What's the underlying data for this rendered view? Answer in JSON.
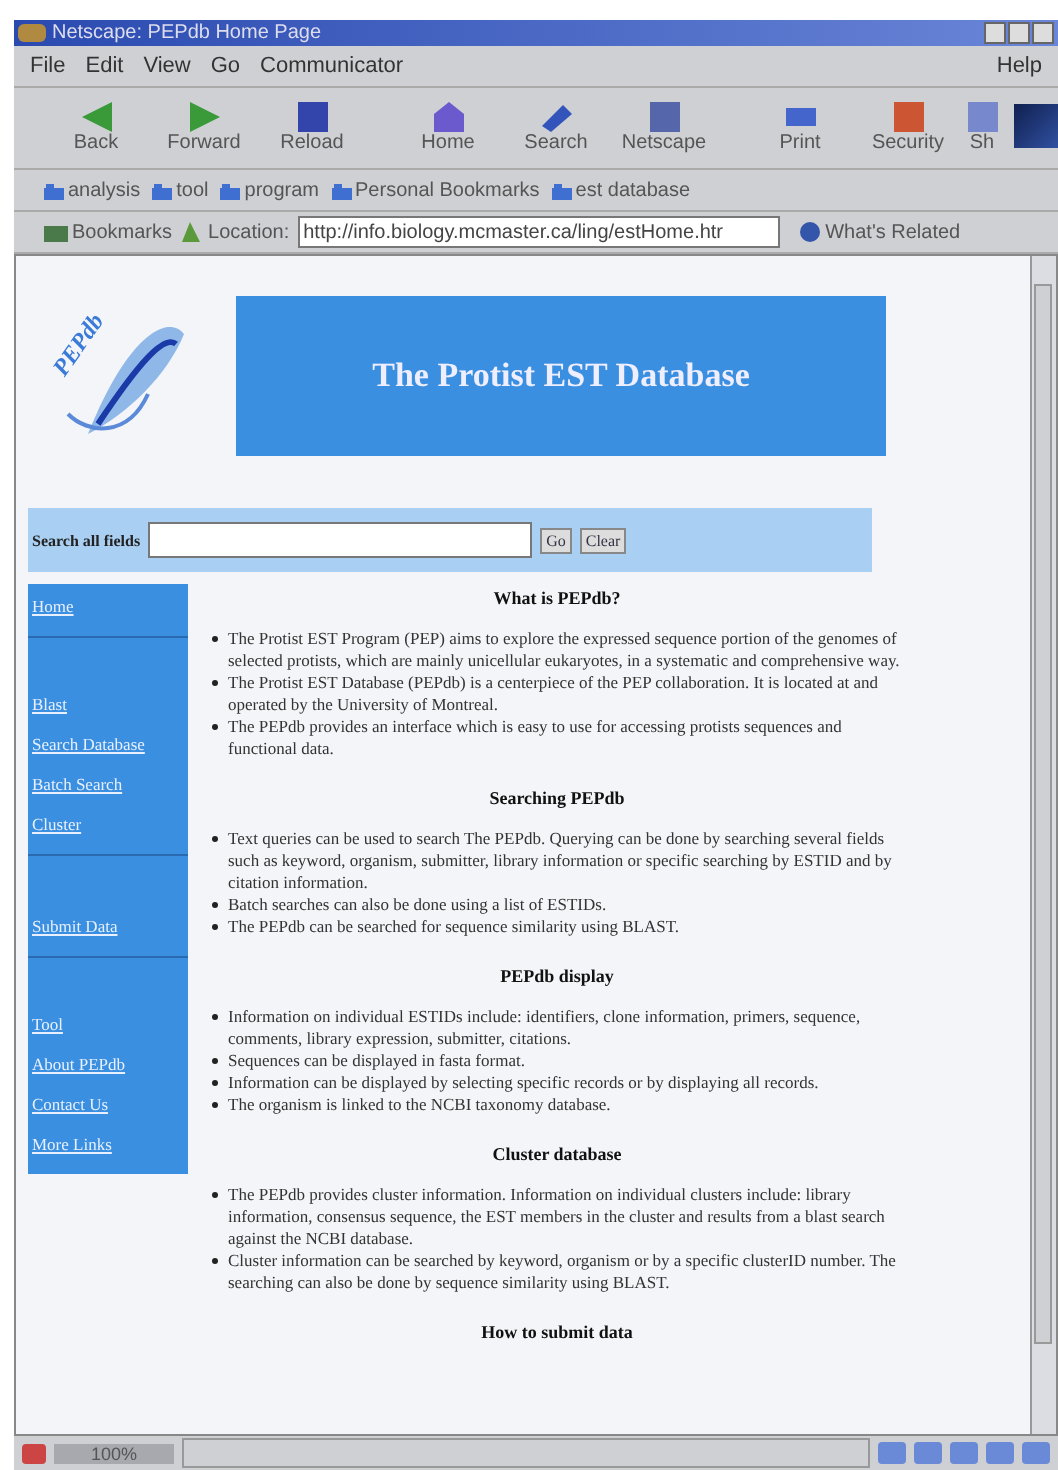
{
  "window": {
    "title": "Netscape: PEPdb Home Page"
  },
  "menu": {
    "items": [
      "File",
      "Edit",
      "View",
      "Go",
      "Communicator"
    ],
    "help": "Help"
  },
  "toolbar": [
    "Back",
    "Forward",
    "Reload",
    "Home",
    "Search",
    "Netscape",
    "Print",
    "Security",
    "Sh"
  ],
  "personal_toolbar": [
    "analysis",
    "tool",
    "program",
    "Personal Bookmarks",
    "est database"
  ],
  "location_bar": {
    "bookmarks": "Bookmarks",
    "label": "Location:",
    "url": "http://info.biology.mcmaster.ca/ling/estHome.htr",
    "related": "What's Related"
  },
  "page": {
    "logo": "PEPdb",
    "banner": "The Protist EST Database",
    "search": {
      "label": "Search all fields",
      "buttons": [
        "Go",
        "Clear"
      ]
    },
    "sidebar": [
      [
        "Home"
      ],
      [
        "Blast",
        "Search Database",
        "Batch Search",
        "Cluster"
      ],
      [
        "Submit Data"
      ],
      [
        "Tool",
        "About PEPdb",
        "Contact Us",
        "More Links"
      ]
    ],
    "sections": [
      {
        "heading": "What is PEPdb?",
        "bullets": [
          "The Protist EST Program (PEP) aims to explore the expressed sequence portion of the genomes of selected protists, which are mainly unicellular eukaryotes, in a systematic and comprehensive way.",
          "The Protist EST Database (PEPdb) is a centerpiece of the PEP collaboration. It is located at and operated by the University of Montreal.",
          "The PEPdb provides an interface which is easy to use for accessing protists sequences and functional data."
        ]
      },
      {
        "heading": "Searching PEPdb",
        "bullets": [
          "Text queries can be used to search The PEPdb. Querying can be done by searching several fields such as keyword, organism, submitter, library information or specific searching by ESTID and by citation information.",
          "Batch searches can also be done using a list of ESTIDs.",
          "The PEPdb can be searched for sequence similarity using BLAST."
        ]
      },
      {
        "heading": "PEPdb display",
        "bullets": [
          "Information on individual ESTIDs include: identifiers, clone information, primers, sequence, comments, library expression, submitter, citations.",
          "Sequences can be displayed in fasta format.",
          "Information can be displayed by selecting specific records or by displaying all records.",
          "The organism is linked to the NCBI taxonomy database."
        ]
      },
      {
        "heading": "Cluster database",
        "bullets": [
          "The PEPdb provides cluster information. Information on individual clusters include: library information, consensus sequence, the EST members in the cluster and results from a blast search against the NCBI database.",
          "Cluster information can be searched by keyword, organism or by a specific clusterID number. The searching can also be done by sequence similarity using BLAST."
        ]
      },
      {
        "heading": "How to submit data"
      }
    ]
  },
  "status_bar": {
    "zoom": "100%"
  }
}
